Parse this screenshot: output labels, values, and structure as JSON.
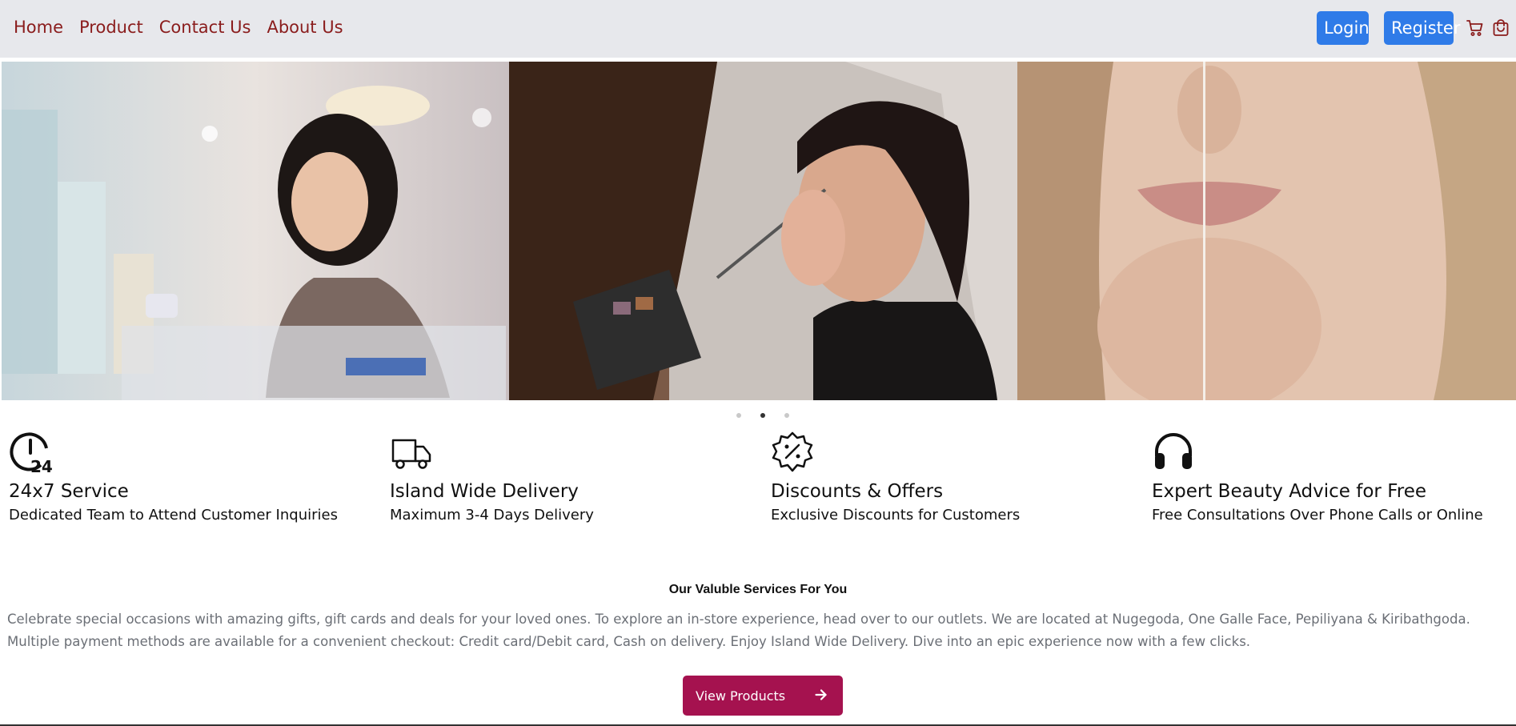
{
  "nav": {
    "links": [
      "Home",
      "Product",
      "Contact Us",
      "About Us"
    ],
    "login_label": "Login",
    "register_label": "Register",
    "icons": [
      "cart-icon",
      "shopping-bag-icon"
    ],
    "link_color": "#8a1c1c",
    "button_color": "#2f7be8"
  },
  "carousel": {
    "slides": [
      "slide-cosmetics-shopper",
      "slide-makeup-application",
      "slide-skin-comparison"
    ],
    "active_index": 1,
    "dot_count": 3
  },
  "features": [
    {
      "icon": "24-hour-clock-icon",
      "title": "24x7 Service",
      "subtitle": "Dedicated Team to Attend Customer Inquiries"
    },
    {
      "icon": "delivery-truck-icon",
      "title": "Island Wide Delivery",
      "subtitle": "Maximum 3-4 Days Delivery"
    },
    {
      "icon": "discount-badge-icon",
      "title": "Discounts & Offers",
      "subtitle": "Exclusive Discounts for Customers"
    },
    {
      "icon": "headphones-icon",
      "title": "Expert Beauty Advice for Free",
      "subtitle": "Free Consultations Over Phone Calls or Online"
    }
  ],
  "services": {
    "title": "Our Valuble Services For You",
    "text": "Celebrate special occasions with amazing gifts, gift cards and deals for your loved ones. To explore an in-store experience, head over to our outlets. We are located at Nugegoda, One Galle Face, Pepiliyana & Kiribathgoda. Multiple payment methods are available for a convenient checkout: Credit card/Debit card, Cash on delivery. Enjoy Island Wide Delivery. Dive into an epic experience now with a few clicks.",
    "button_label": "View Products",
    "button_color": "#a5124f"
  }
}
